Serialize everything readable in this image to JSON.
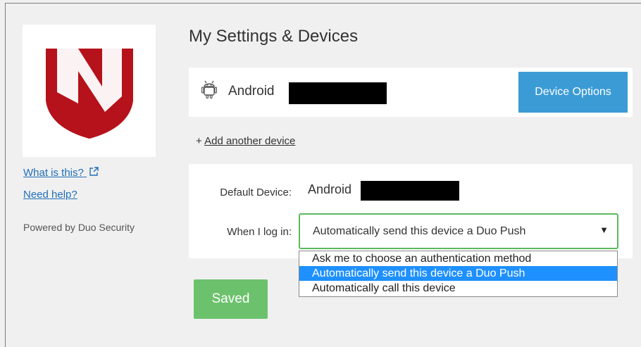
{
  "sidebar": {
    "what_is_this": "What is this?",
    "need_help": "Need help?",
    "powered_by": "Powered by Duo Security"
  },
  "header": {
    "title": "My Settings & Devices"
  },
  "device": {
    "name": "Android",
    "options_button": "Device Options"
  },
  "add_device": {
    "prefix": "+ ",
    "link": "Add another device"
  },
  "settings": {
    "default_device_label": "Default Device:",
    "default_device_value": "Android",
    "login_label": "When I log in:",
    "login_selected": "Automatically send this device a Duo Push",
    "login_options": [
      "Ask me to choose an authentication method",
      "Automatically send this device a Duo Push",
      "Automatically call this device"
    ]
  },
  "save_button": "Saved",
  "colors": {
    "brand_red": "#b5121b",
    "accent_blue": "#3a9bd5",
    "success_green": "#6cc26c",
    "link_blue": "#1f6fb8"
  },
  "icons": [
    "android-icon",
    "external-link-icon",
    "dropdown-arrow-icon"
  ]
}
